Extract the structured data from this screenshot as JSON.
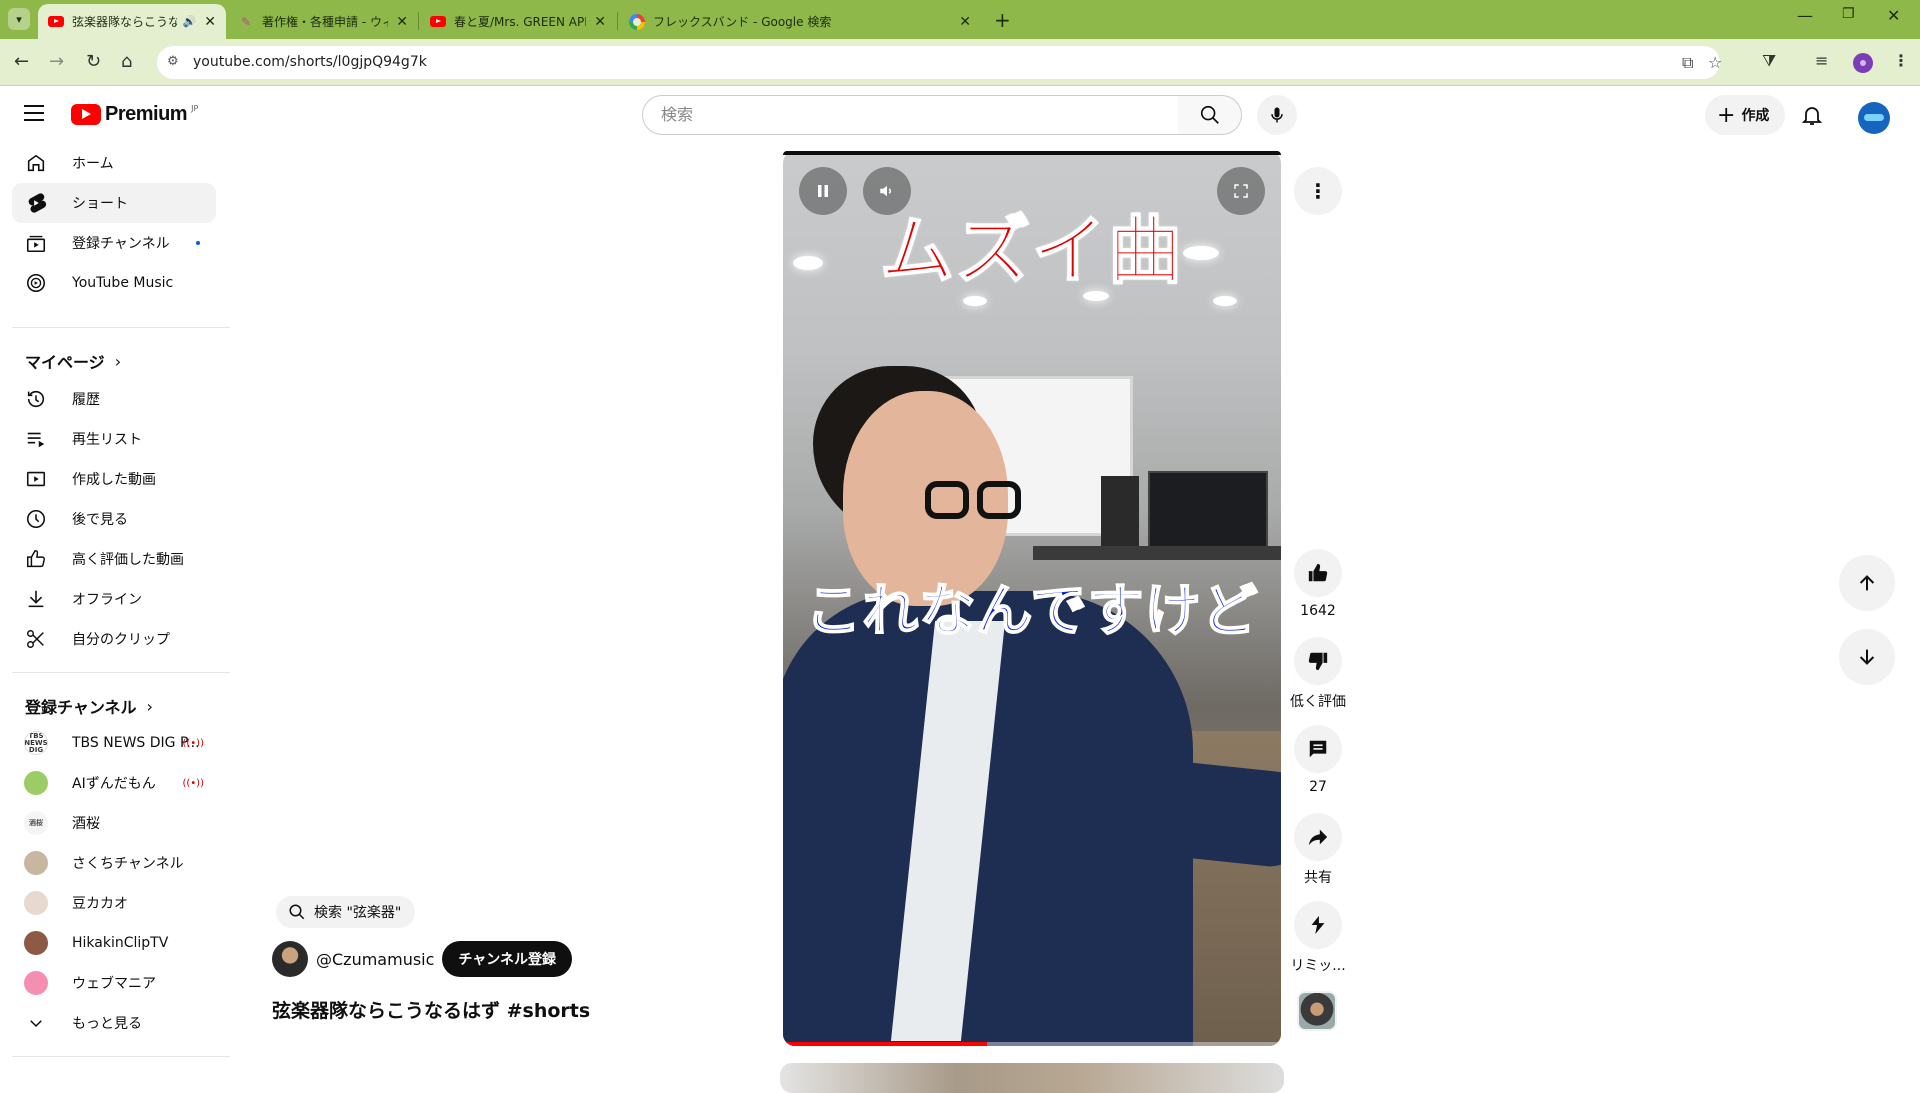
{
  "browser": {
    "tabs": [
      {
        "title": "弦楽器隊ならこうなるはず #sh",
        "favicon": "youtube-icon",
        "active": true,
        "audio": true
      },
      {
        "title": "著作権・各種申請 - ウィンズスコア",
        "favicon": "pen-icon",
        "active": false
      },
      {
        "title": "春と夏/Mrs. GREEN APPLE【大阪",
        "favicon": "youtube-icon",
        "active": false
      },
      {
        "title": "フレックスバンド - Google 検索",
        "favicon": "google-icon",
        "active": false
      }
    ],
    "url": "youtube.com/shorts/l0gjpQ94g7k",
    "accent_color": "#8fb84a"
  },
  "header": {
    "logo_text": "Premium",
    "logo_region": "JP",
    "search_placeholder": "検索",
    "create_label": "作成"
  },
  "sidebar": {
    "main": [
      {
        "label": "ホーム",
        "icon": "home-icon"
      },
      {
        "label": "ショート",
        "icon": "shorts-icon",
        "active": true
      },
      {
        "label": "登録チャンネル",
        "icon": "subscriptions-icon",
        "new_dot": true
      },
      {
        "label": "YouTube Music",
        "icon": "youtube-music-icon"
      }
    ],
    "you_heading": "マイページ",
    "you": [
      {
        "label": "履歴",
        "icon": "history-icon"
      },
      {
        "label": "再生リスト",
        "icon": "playlist-icon"
      },
      {
        "label": "作成した動画",
        "icon": "your-videos-icon"
      },
      {
        "label": "後で見る",
        "icon": "watch-later-icon"
      },
      {
        "label": "高く評価した動画",
        "icon": "thumbs-up-icon"
      },
      {
        "label": "オフライン",
        "icon": "download-icon"
      },
      {
        "label": "自分のクリップ",
        "icon": "scissors-icon"
      }
    ],
    "subs_heading": "登録チャンネル",
    "subscriptions": [
      {
        "label": "TBS NEWS DIG P...",
        "live": true,
        "avatar_text": "TBS NEWS DIG",
        "avatar_color": "#ffffff"
      },
      {
        "label": "AIずんだもん",
        "live": true,
        "avatar_color": "#9ccc65"
      },
      {
        "label": "酒桜",
        "live": false,
        "avatar_text": "酒桜",
        "avatar_color": "#f5f5f5"
      },
      {
        "label": "さくちチャンネル",
        "live": false,
        "avatar_color": "#c8b7a0"
      },
      {
        "label": "豆カカオ",
        "live": false,
        "avatar_color": "#e8d9cf"
      },
      {
        "label": "HikakinClipTV",
        "live": false,
        "avatar_color": "#8d5a44"
      },
      {
        "label": "ウェブマニア",
        "live": false,
        "avatar_color": "#f48fb1"
      }
    ],
    "show_more_label": "もっと見る"
  },
  "short": {
    "caption_top": "ムズイ曲",
    "caption_mid": "これなんですけど",
    "progress": 0.41,
    "search_chip": "検索 \"弦楽器\"",
    "channel": "@Czumamusic",
    "subscribe_label": "チャンネル登録",
    "title": "弦楽器隊ならこうなるはず #shorts"
  },
  "actions": {
    "like_count": "1642",
    "dislike_label": "低く評価",
    "comment_count": "27",
    "share_label": "共有",
    "remix_label": "リミッ..."
  }
}
